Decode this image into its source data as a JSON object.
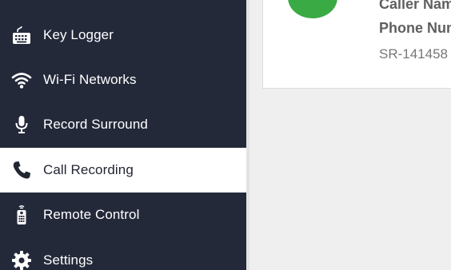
{
  "sidebar": {
    "items": [
      {
        "label": "Key Logger",
        "icon": "keyboard-icon",
        "active": false
      },
      {
        "label": "Wi-Fi Networks",
        "icon": "wifi-icon",
        "active": false
      },
      {
        "label": "Record Surround",
        "icon": "microphone-icon",
        "active": false
      },
      {
        "label": "Call Recording",
        "icon": "phone-icon",
        "active": true
      },
      {
        "label": "Remote Control",
        "icon": "remote-control-icon",
        "active": false
      },
      {
        "label": "Settings",
        "icon": "gear-icon",
        "active": false
      }
    ]
  },
  "card": {
    "caller_name": "Caller Name",
    "phone_number": "Phone Number",
    "record_id": "SR-141458"
  },
  "colors": {
    "sidebar_bg": "#24293a",
    "active_bg": "#ffffff",
    "avatar": "#3aaa45",
    "content_bg": "#efefef"
  }
}
